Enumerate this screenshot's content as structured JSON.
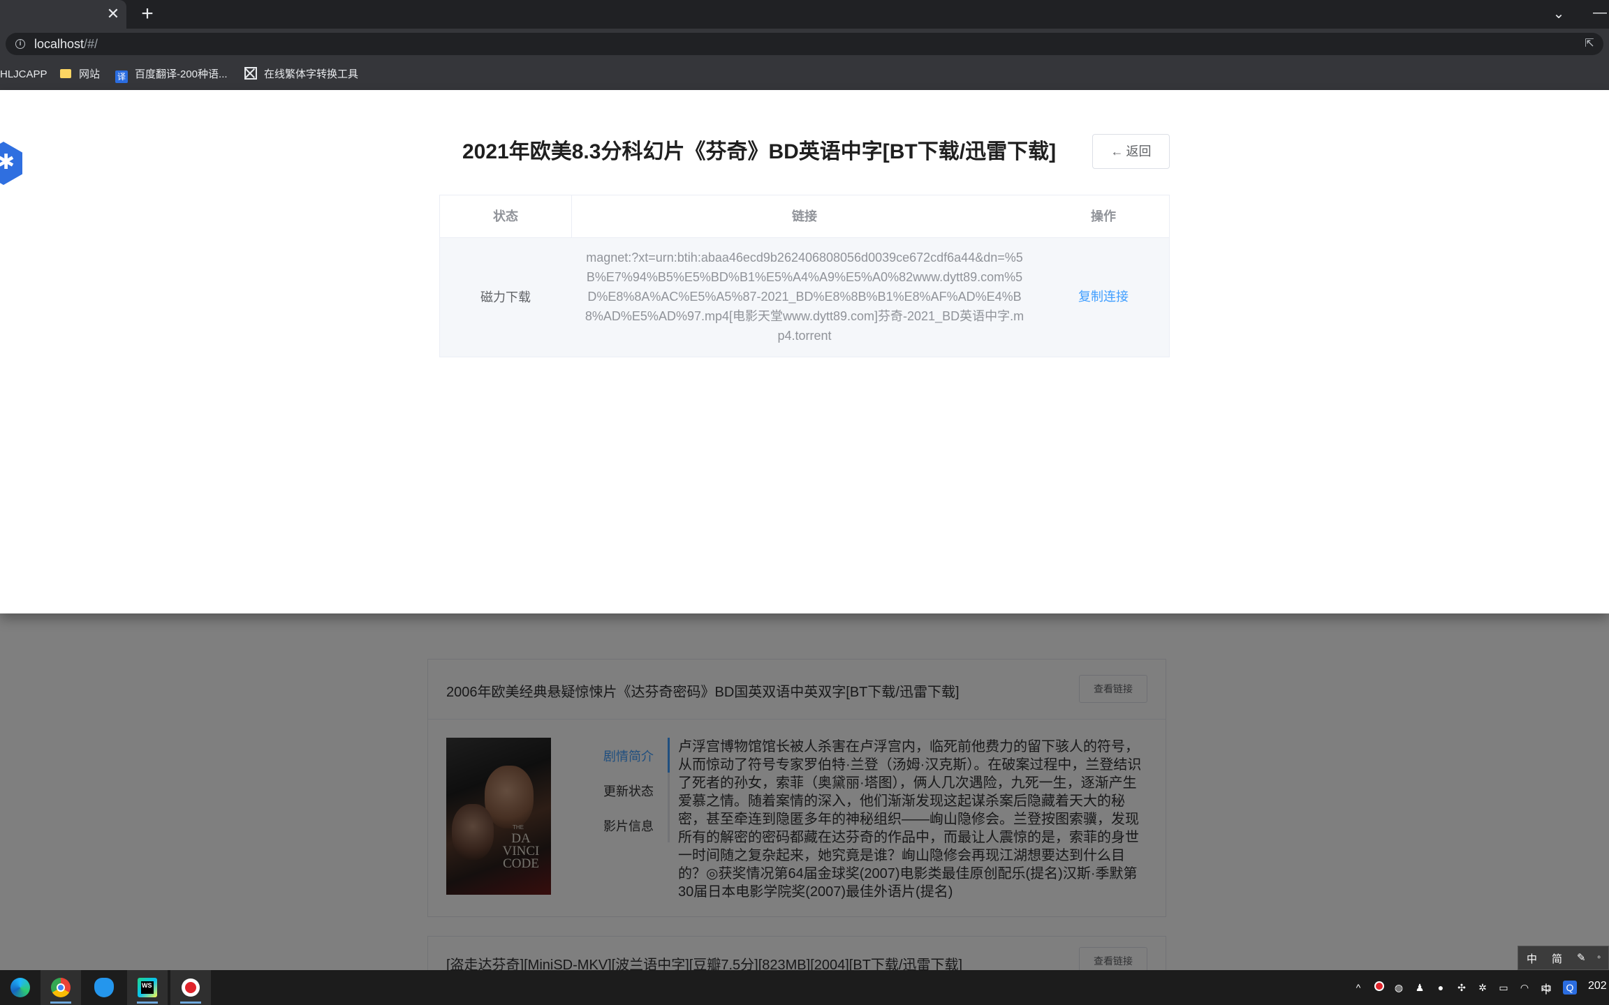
{
  "browser": {
    "tab_close": "✕",
    "new_tab": "+",
    "url_host": "localhost",
    "url_path": "/#/",
    "bookmarks": [
      {
        "label": "HLJCAPP",
        "icon": "none"
      },
      {
        "label": "网站",
        "icon": "folder-icon"
      },
      {
        "label": "百度翻译-200种语...",
        "icon": "translate-icon"
      },
      {
        "label": "在线繁体字转换工具",
        "icon": "converter-icon"
      }
    ]
  },
  "drawer": {
    "title": "2021年欧美8.3分科幻片《芬奇》BD英语中字[BT下载/迅雷下载]",
    "back_label": "返回",
    "table": {
      "headers": [
        "状态",
        "链接",
        "操作"
      ],
      "rows": [
        {
          "status": "磁力下载",
          "link": "magnet:?xt=urn:btih:abaa46ecd9b262406808056d0039ce672cdf6a44&dn=%5B%E7%94%B5%E5%BD%B1%E5%A4%A9%E5%A0%82www.dytt89.com%5D%E8%8A%AC%E5%A5%87-2021_BD%E8%8B%B1%E8%AF%AD%E4%B8%AD%E5%AD%97.mp4[电影天堂www.dytt89.com]芬奇-2021_BD英语中字.mp4.torrent",
          "action": "复制连接"
        }
      ]
    }
  },
  "background": {
    "card": {
      "title": "2006年欧美经典悬疑惊悚片《达芬奇密码》BD国英双语中英双字[BT下载/迅雷下载]",
      "view_link_label": "查看链接",
      "poster_text": "DA VINCI CODE",
      "poster_small": "THE",
      "tabs": [
        "剧情简介",
        "更新状态",
        "影片信息"
      ],
      "active_tab": "剧情简介",
      "synopsis": "卢浮宫博物馆馆长被人杀害在卢浮宫内，临死前他费力的留下骇人的符号，从而惊动了符号专家罗伯特·兰登（汤姆·汉克斯）。在破案过程中，兰登结识了死者的孙女，索菲（奥黛丽·塔图），俩人几次遇险，九死一生，逐渐产生爱慕之情。随着案情的深入，他们渐渐发现这起谋杀案后隐藏着天大的秘密，甚至牵连到隐匿多年的神秘组织——峋山隐修会。兰登按图索骥，发现所有的解密的密码都藏在达芬奇的作品中，而最让人震惊的是，索菲的身世一时间随之复杂起来，她究竟是谁？峋山隐修会再现江湖想要达到什么目的？◎获奖情况第64届金球奖(2007)电影类最佳原创配乐(提名)汉斯·季默第30届日本电影学院奖(2007)最佳外语片(提名)"
    },
    "card2": {
      "title": "[盗走达芬奇][MiniSD-MKV][波兰语中字][豆瓣7.5分][823MB][2004][BT下载/迅雷下载]",
      "view_link_label": "查看链接"
    }
  },
  "ime": {
    "a": "中",
    "b": "简"
  },
  "taskbar": {
    "apps": [
      "edge-icon",
      "chrome-icon",
      "docker-icon",
      "webstorm-icon",
      "recorder-icon"
    ],
    "lang": "中",
    "clock": "202"
  }
}
